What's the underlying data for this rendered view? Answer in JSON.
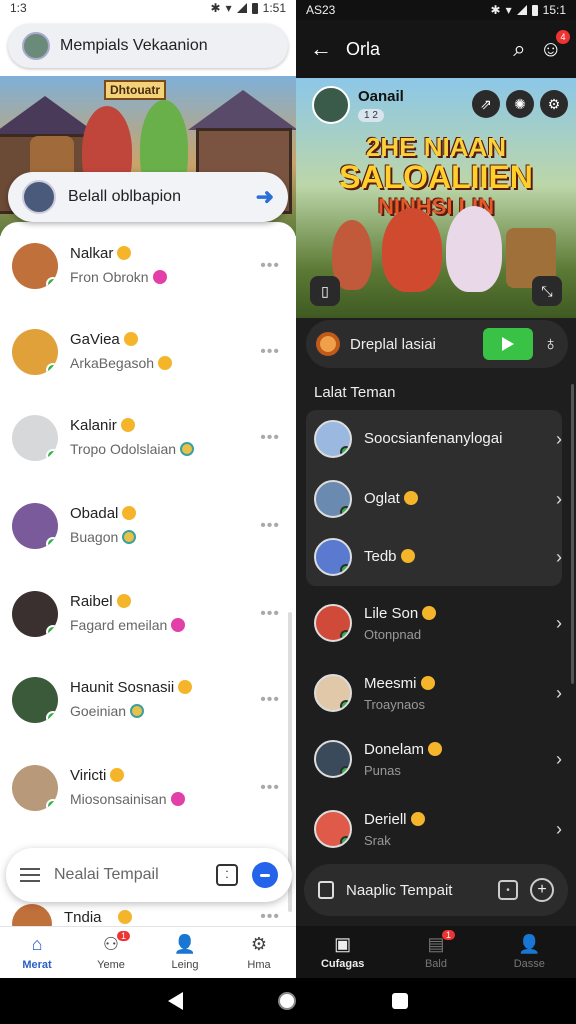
{
  "left": {
    "status": {
      "time": "1:3",
      "right_time": "1:51"
    },
    "search": {
      "label": "Mempials Vekaanion"
    },
    "banner": {
      "sign": "Dhtouatr"
    },
    "conversation": {
      "label": "Belall oblbapion"
    },
    "chats": [
      {
        "name": "Nalkar",
        "preview": "Fron Obrokn",
        "color": "#c0703a"
      },
      {
        "name": "GaViea",
        "preview": "ArkaBegasoh",
        "color": "#e0a03a"
      },
      {
        "name": "Kalanir",
        "preview": "Tropo Odolslaian",
        "color": "#d6d8da"
      },
      {
        "name": "Obadal",
        "preview": "Buagon",
        "color": "#7a5a9a"
      },
      {
        "name": "Raibel",
        "preview": "Fagard emeilan",
        "color": "#3a3030"
      },
      {
        "name": "Haunit Sosnasii",
        "preview": "Goeinian",
        "color": "#3a5a3a"
      },
      {
        "name": "Viricti",
        "preview": "Miosonsainisan",
        "color": "#b89a7a"
      }
    ],
    "partial_chat": {
      "name": "Tndia"
    },
    "compose": {
      "placeholder": "Nealai Tempail"
    },
    "nav": [
      {
        "label": "Merat",
        "icon": "home-icon"
      },
      {
        "label": "Yeme",
        "icon": "people-icon",
        "badge": "1"
      },
      {
        "label": "Leing",
        "icon": "person-icon"
      },
      {
        "label": "Hma",
        "icon": "settings-icon"
      }
    ]
  },
  "right": {
    "status": {
      "time": "AS23",
      "right_time": "15:1"
    },
    "topbar": {
      "title": "Orla",
      "notif_badge": "4"
    },
    "banner": {
      "profile_name": "Oanail",
      "profile_tag": "1 2",
      "title_line1": "2HE NIAAN",
      "title_line2": "SALOALIIEN",
      "title_line3": "NINHSI LIN"
    },
    "media": {
      "label": "Dreplal lasiai"
    },
    "section": {
      "title": "Lalat Teman"
    },
    "friends": [
      {
        "name": "Soocsianfenanylogai",
        "sub": "",
        "color": "#9ab8e0"
      },
      {
        "name": "Oglat",
        "sub": "",
        "color": "#6a8ab0"
      },
      {
        "name": "Tedb",
        "sub": "",
        "color": "#5a7ad0"
      },
      {
        "name": "Lile Son",
        "sub": "Otonpnad",
        "color": "#d04a3a"
      },
      {
        "name": "Meesmi",
        "sub": "Troaynaos",
        "color": "#e0c8a8"
      },
      {
        "name": "Donelam",
        "sub": "Punas",
        "color": "#3a4a5a"
      },
      {
        "name": "Deriell",
        "sub": "Srak",
        "color": "#e05a4a"
      }
    ],
    "compose": {
      "placeholder": "Naaplic Tempait"
    },
    "nav": [
      {
        "label": "Cufagas",
        "icon": "chat-icon"
      },
      {
        "label": "Bald",
        "icon": "gallery-icon",
        "badge": "1"
      },
      {
        "label": "Dasse",
        "icon": "person-icon"
      }
    ]
  }
}
